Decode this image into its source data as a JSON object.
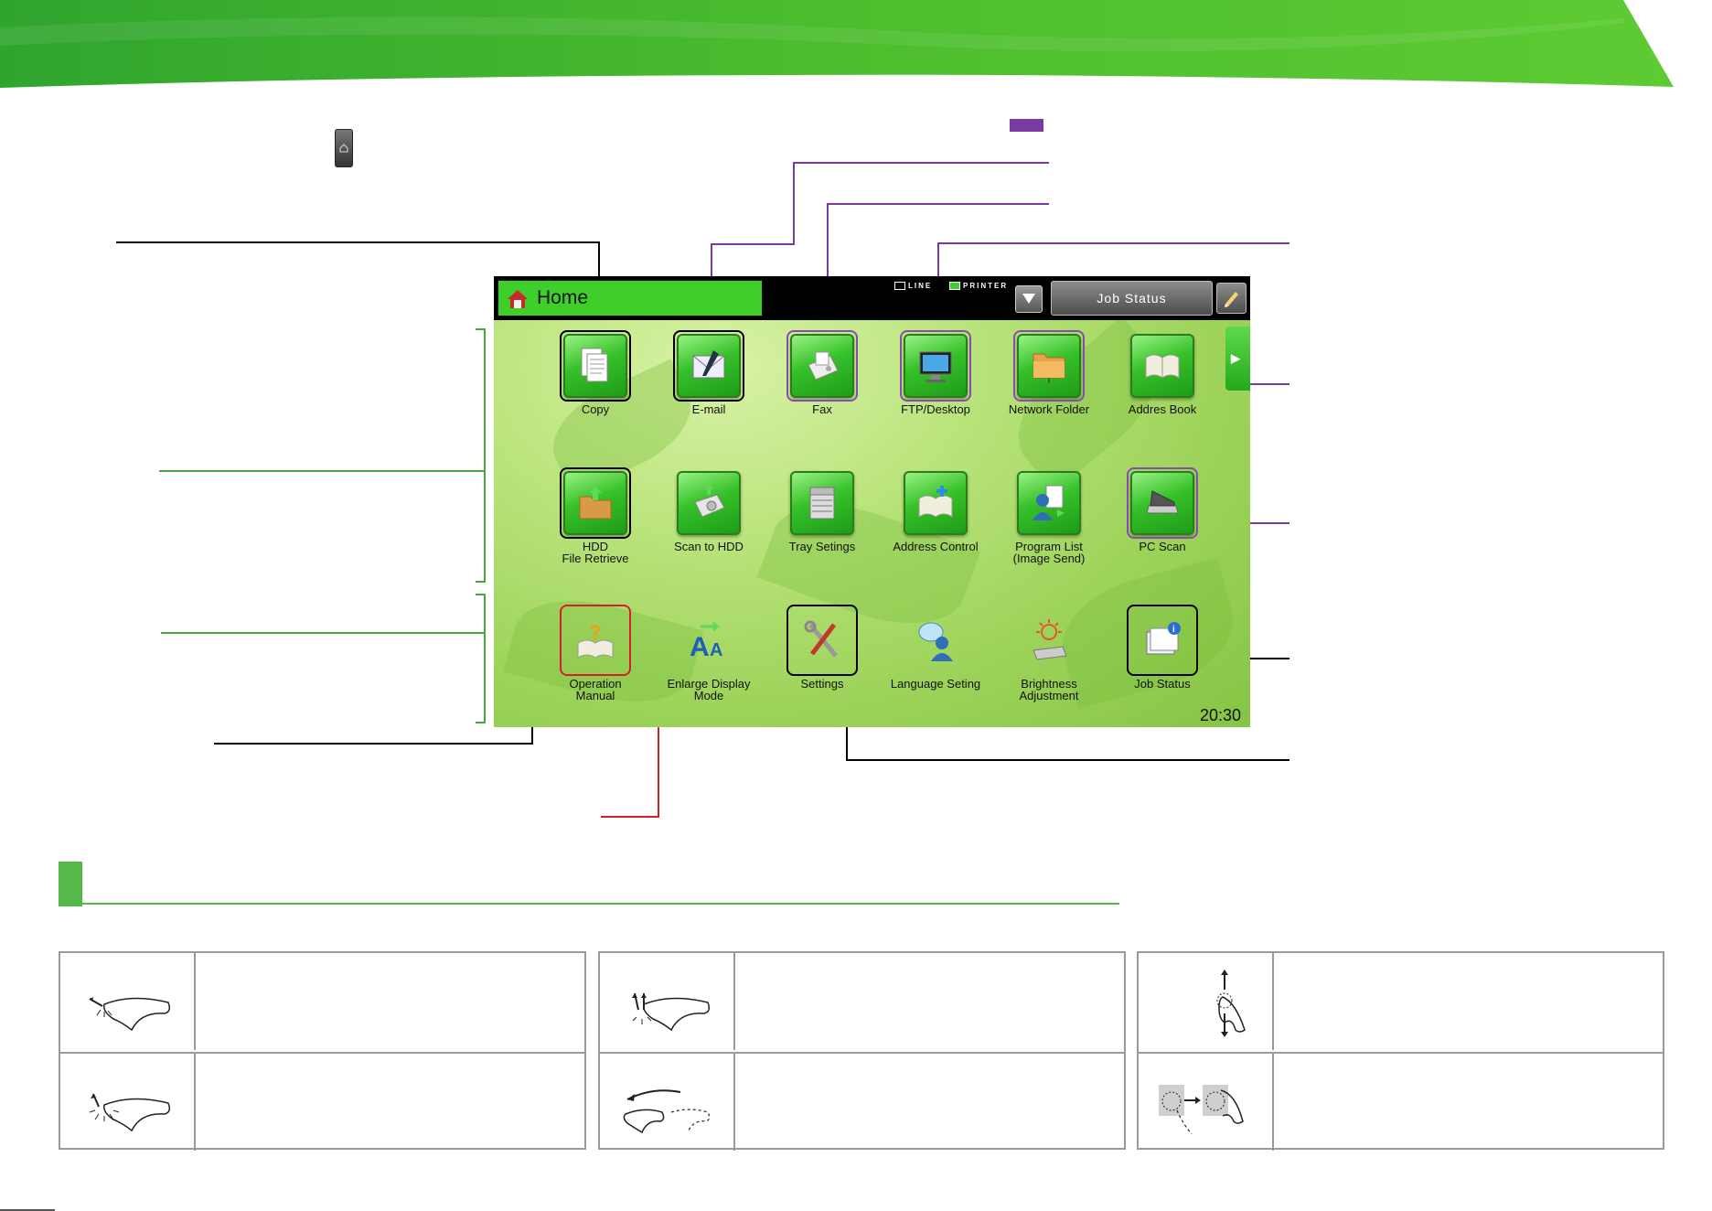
{
  "accent_colors": {
    "banner_green": "#4cbd2e",
    "callout_purple": "#7b3aa3",
    "callout_red": "#d4202a",
    "callout_green": "#4aa640",
    "section_green": "#55b84a"
  },
  "icons": {
    "device_button": "home-key-icon",
    "legend_badge": "purple-legend-badge"
  },
  "screen": {
    "title": "Home",
    "mode_indicators": [
      "LINE",
      "PRINTER"
    ],
    "job_status_button": "Job Status",
    "clock": "20:30",
    "apps": [
      {
        "label": "Copy",
        "icon": "copy-icon"
      },
      {
        "label": "E-mail",
        "icon": "email-icon"
      },
      {
        "label": "Fax",
        "icon": "fax-icon"
      },
      {
        "label": "FTP/Desktop",
        "icon": "ftp-desktop-icon"
      },
      {
        "label": "Network Folder",
        "icon": "network-folder-icon"
      },
      {
        "label": "Addres Book",
        "icon": "address-book-icon"
      },
      {
        "label": "HDD\nFile Retrieve",
        "icon": "hdd-file-retrieve-icon"
      },
      {
        "label": "Scan to HDD",
        "icon": "scan-to-hdd-icon"
      },
      {
        "label": "Tray Setings",
        "icon": "tray-settings-icon"
      },
      {
        "label": "Address Control",
        "icon": "address-control-icon"
      },
      {
        "label": "Program List\n(Image Send)",
        "icon": "program-list-icon"
      },
      {
        "label": "PC Scan",
        "icon": "pc-scan-icon"
      },
      {
        "label": "Operation\nManual",
        "icon": "operation-manual-icon"
      },
      {
        "label": "Enlarge Display\nMode",
        "icon": "enlarge-display-icon"
      },
      {
        "label": "Settings",
        "icon": "settings-icon"
      },
      {
        "label": "Language Seting",
        "icon": "language-setting-icon"
      },
      {
        "label": "Brightness\nAdjustment",
        "icon": "brightness-icon"
      },
      {
        "label": "Job Status",
        "icon": "job-status-icon"
      }
    ]
  },
  "gestures": [
    {
      "icon": "tap-gesture-icon"
    },
    {
      "icon": "long-press-gesture-icon"
    },
    {
      "icon": "double-tap-gesture-icon"
    },
    {
      "icon": "flick-gesture-icon"
    },
    {
      "icon": "scroll-gesture-icon"
    },
    {
      "icon": "drag-gesture-icon"
    }
  ]
}
